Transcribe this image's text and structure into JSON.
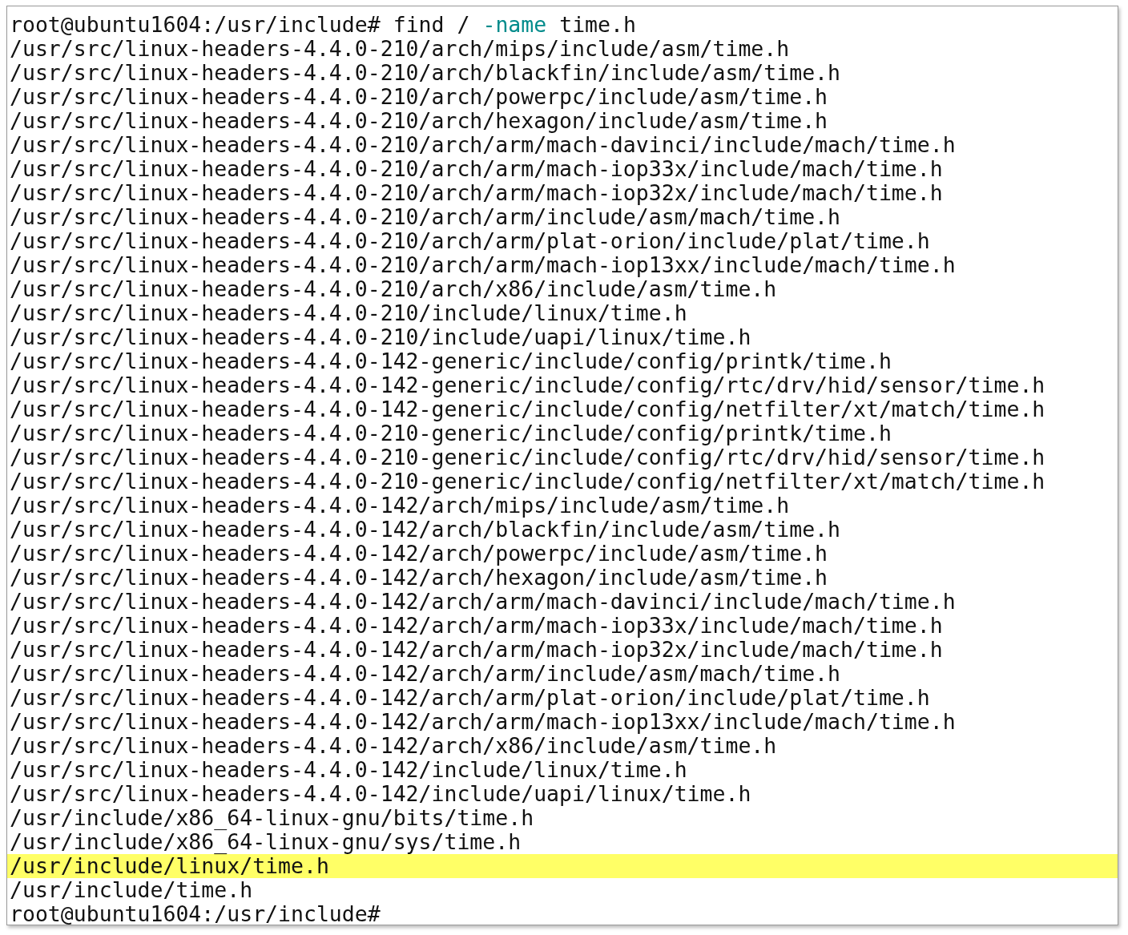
{
  "terminal": {
    "lines": [
      {
        "kind": "command",
        "prompt": "root@ubuntu1604:/usr/include#",
        "command": "find /",
        "option": "-name",
        "argument": "time.h",
        "highlighted": false
      },
      {
        "kind": "output",
        "text": "/usr/src/linux-headers-4.4.0-210/arch/mips/include/asm/time.h",
        "highlighted": false
      },
      {
        "kind": "output",
        "text": "/usr/src/linux-headers-4.4.0-210/arch/blackfin/include/asm/time.h",
        "highlighted": false
      },
      {
        "kind": "output",
        "text": "/usr/src/linux-headers-4.4.0-210/arch/powerpc/include/asm/time.h",
        "highlighted": false
      },
      {
        "kind": "output",
        "text": "/usr/src/linux-headers-4.4.0-210/arch/hexagon/include/asm/time.h",
        "highlighted": false
      },
      {
        "kind": "output",
        "text": "/usr/src/linux-headers-4.4.0-210/arch/arm/mach-davinci/include/mach/time.h",
        "highlighted": false
      },
      {
        "kind": "output",
        "text": "/usr/src/linux-headers-4.4.0-210/arch/arm/mach-iop33x/include/mach/time.h",
        "highlighted": false
      },
      {
        "kind": "output",
        "text": "/usr/src/linux-headers-4.4.0-210/arch/arm/mach-iop32x/include/mach/time.h",
        "highlighted": false
      },
      {
        "kind": "output",
        "text": "/usr/src/linux-headers-4.4.0-210/arch/arm/include/asm/mach/time.h",
        "highlighted": false
      },
      {
        "kind": "output",
        "text": "/usr/src/linux-headers-4.4.0-210/arch/arm/plat-orion/include/plat/time.h",
        "highlighted": false
      },
      {
        "kind": "output",
        "text": "/usr/src/linux-headers-4.4.0-210/arch/arm/mach-iop13xx/include/mach/time.h",
        "highlighted": false
      },
      {
        "kind": "output",
        "text": "/usr/src/linux-headers-4.4.0-210/arch/x86/include/asm/time.h",
        "highlighted": false
      },
      {
        "kind": "output",
        "text": "/usr/src/linux-headers-4.4.0-210/include/linux/time.h",
        "highlighted": false
      },
      {
        "kind": "output",
        "text": "/usr/src/linux-headers-4.4.0-210/include/uapi/linux/time.h",
        "highlighted": false
      },
      {
        "kind": "output",
        "text": "/usr/src/linux-headers-4.4.0-142-generic/include/config/printk/time.h",
        "highlighted": false
      },
      {
        "kind": "output",
        "text": "/usr/src/linux-headers-4.4.0-142-generic/include/config/rtc/drv/hid/sensor/time.h",
        "highlighted": false
      },
      {
        "kind": "output",
        "text": "/usr/src/linux-headers-4.4.0-142-generic/include/config/netfilter/xt/match/time.h",
        "highlighted": false
      },
      {
        "kind": "output",
        "text": "/usr/src/linux-headers-4.4.0-210-generic/include/config/printk/time.h",
        "highlighted": false
      },
      {
        "kind": "output",
        "text": "/usr/src/linux-headers-4.4.0-210-generic/include/config/rtc/drv/hid/sensor/time.h",
        "highlighted": false
      },
      {
        "kind": "output",
        "text": "/usr/src/linux-headers-4.4.0-210-generic/include/config/netfilter/xt/match/time.h",
        "highlighted": false
      },
      {
        "kind": "output",
        "text": "/usr/src/linux-headers-4.4.0-142/arch/mips/include/asm/time.h",
        "highlighted": false
      },
      {
        "kind": "output",
        "text": "/usr/src/linux-headers-4.4.0-142/arch/blackfin/include/asm/time.h",
        "highlighted": false
      },
      {
        "kind": "output",
        "text": "/usr/src/linux-headers-4.4.0-142/arch/powerpc/include/asm/time.h",
        "highlighted": false
      },
      {
        "kind": "output",
        "text": "/usr/src/linux-headers-4.4.0-142/arch/hexagon/include/asm/time.h",
        "highlighted": false
      },
      {
        "kind": "output",
        "text": "/usr/src/linux-headers-4.4.0-142/arch/arm/mach-davinci/include/mach/time.h",
        "highlighted": false
      },
      {
        "kind": "output",
        "text": "/usr/src/linux-headers-4.4.0-142/arch/arm/mach-iop33x/include/mach/time.h",
        "highlighted": false
      },
      {
        "kind": "output",
        "text": "/usr/src/linux-headers-4.4.0-142/arch/arm/mach-iop32x/include/mach/time.h",
        "highlighted": false
      },
      {
        "kind": "output",
        "text": "/usr/src/linux-headers-4.4.0-142/arch/arm/include/asm/mach/time.h",
        "highlighted": false
      },
      {
        "kind": "output",
        "text": "/usr/src/linux-headers-4.4.0-142/arch/arm/plat-orion/include/plat/time.h",
        "highlighted": false
      },
      {
        "kind": "output",
        "text": "/usr/src/linux-headers-4.4.0-142/arch/arm/mach-iop13xx/include/mach/time.h",
        "highlighted": false
      },
      {
        "kind": "output",
        "text": "/usr/src/linux-headers-4.4.0-142/arch/x86/include/asm/time.h",
        "highlighted": false
      },
      {
        "kind": "output",
        "text": "/usr/src/linux-headers-4.4.0-142/include/linux/time.h",
        "highlighted": false
      },
      {
        "kind": "output",
        "text": "/usr/src/linux-headers-4.4.0-142/include/uapi/linux/time.h",
        "highlighted": false
      },
      {
        "kind": "output",
        "text": "/usr/include/x86_64-linux-gnu/bits/time.h",
        "highlighted": false
      },
      {
        "kind": "output",
        "text": "/usr/include/x86_64-linux-gnu/sys/time.h",
        "highlighted": false
      },
      {
        "kind": "output",
        "text": "/usr/include/linux/time.h",
        "highlighted": true
      },
      {
        "kind": "output",
        "text": "/usr/include/time.h",
        "highlighted": false
      },
      {
        "kind": "prompt",
        "prompt": "root@ubuntu1604:/usr/include#",
        "highlighted": false
      }
    ]
  }
}
